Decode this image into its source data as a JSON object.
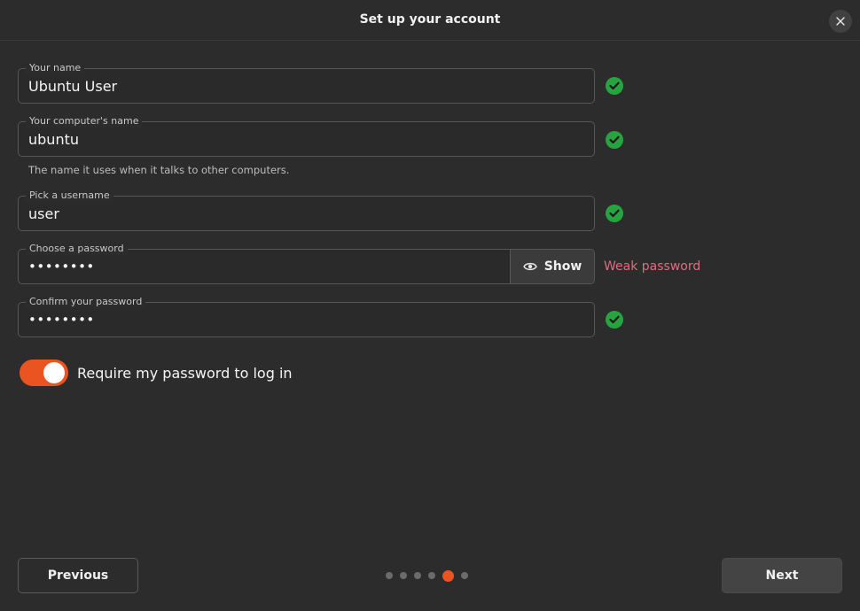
{
  "window": {
    "title": "Set up your account"
  },
  "form": {
    "name": {
      "label": "Your name",
      "value": "Ubuntu User"
    },
    "computer": {
      "label": "Your computer's name",
      "value": "ubuntu",
      "helper": "The name it uses when it talks to other computers."
    },
    "username": {
      "label": "Pick a username",
      "value": "user"
    },
    "password": {
      "label": "Choose a password",
      "value": "••••••••",
      "show_label": "Show",
      "strength": "Weak password"
    },
    "confirm": {
      "label": "Confirm your password",
      "value": "••••••••"
    }
  },
  "toggle": {
    "label": "Require my password to log in",
    "on": true
  },
  "footer": {
    "previous_label": "Previous",
    "next_label": "Next",
    "page_count": 6,
    "current_page": 5
  },
  "colors": {
    "accent": "#e95420",
    "valid": "#27a33f",
    "warning": "#e06c80"
  }
}
